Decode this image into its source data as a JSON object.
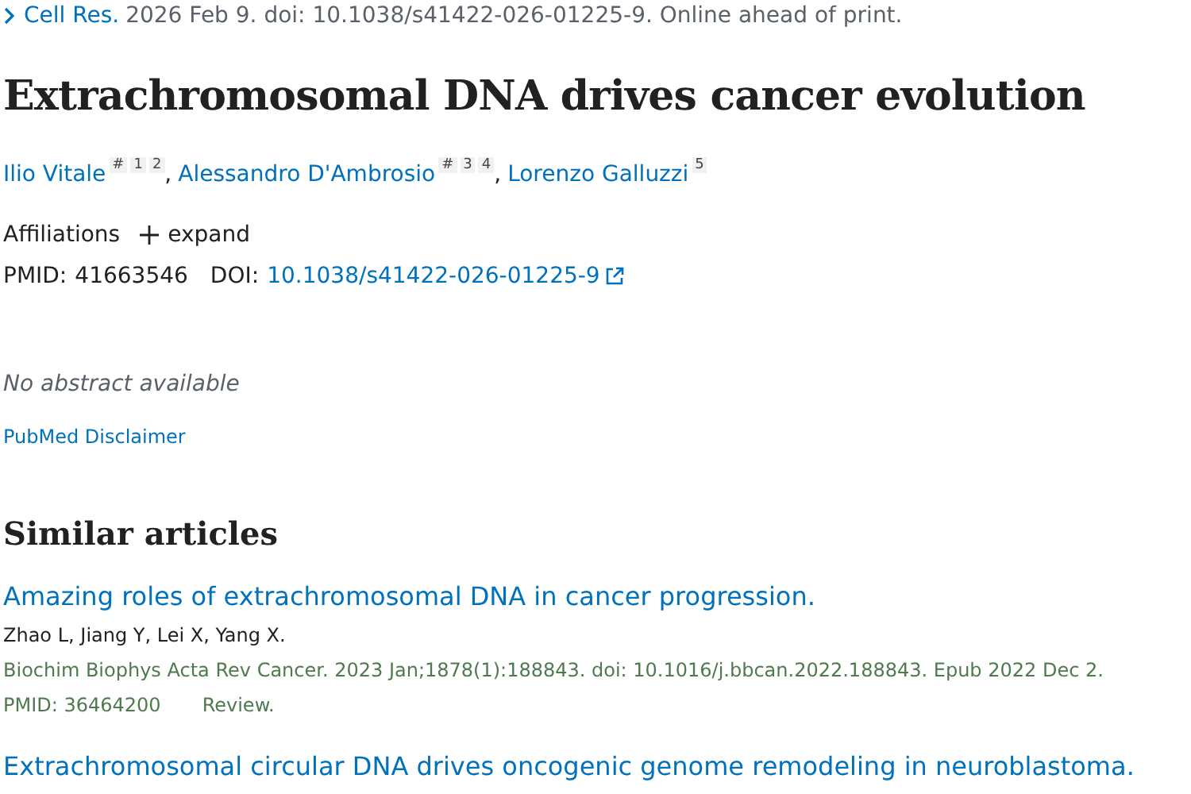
{
  "citation": {
    "journal": "Cell Res.",
    "details": "2026 Feb 9. doi: 10.1038/s41422-026-01225-9. Online ahead of print."
  },
  "title": "Extrachromosomal DNA drives cancer evolution",
  "author_separator": ",",
  "authors": [
    {
      "name": "Ilio Vitale",
      "marks": [
        "#",
        "1",
        "2"
      ]
    },
    {
      "name": "Alessandro D'Ambrosio",
      "marks": [
        "#",
        "3",
        "4"
      ]
    },
    {
      "name": "Lorenzo Galluzzi",
      "marks": [
        "5"
      ]
    }
  ],
  "affiliations": {
    "label": "Affiliations",
    "toggle": "expand",
    "expanded": false
  },
  "identifiers": {
    "pmid_label": "PMID:",
    "pmid": "41663546",
    "doi_label": "DOI:",
    "doi": "10.1038/s41422-026-01225-9"
  },
  "abstract_note": "No abstract available",
  "disclaimer_link": "PubMed Disclaimer",
  "similar_articles": {
    "heading": "Similar articles",
    "items": [
      {
        "title": "Amazing roles of extrachromosomal DNA in cancer progression.",
        "authors": "Zhao L, Jiang Y, Lei X, Yang X.",
        "source": "Biochim Biophys Acta Rev Cancer. 2023 Jan;1878(1):188843. doi: 10.1016/j.bbcan.2022.188843. Epub 2022 Dec 2.",
        "pmid": "PMID: 36464200",
        "type": "Review."
      },
      {
        "title": "Extrachromosomal circular DNA drives oncogenic genome remodeling in neuroblastoma."
      }
    ]
  }
}
